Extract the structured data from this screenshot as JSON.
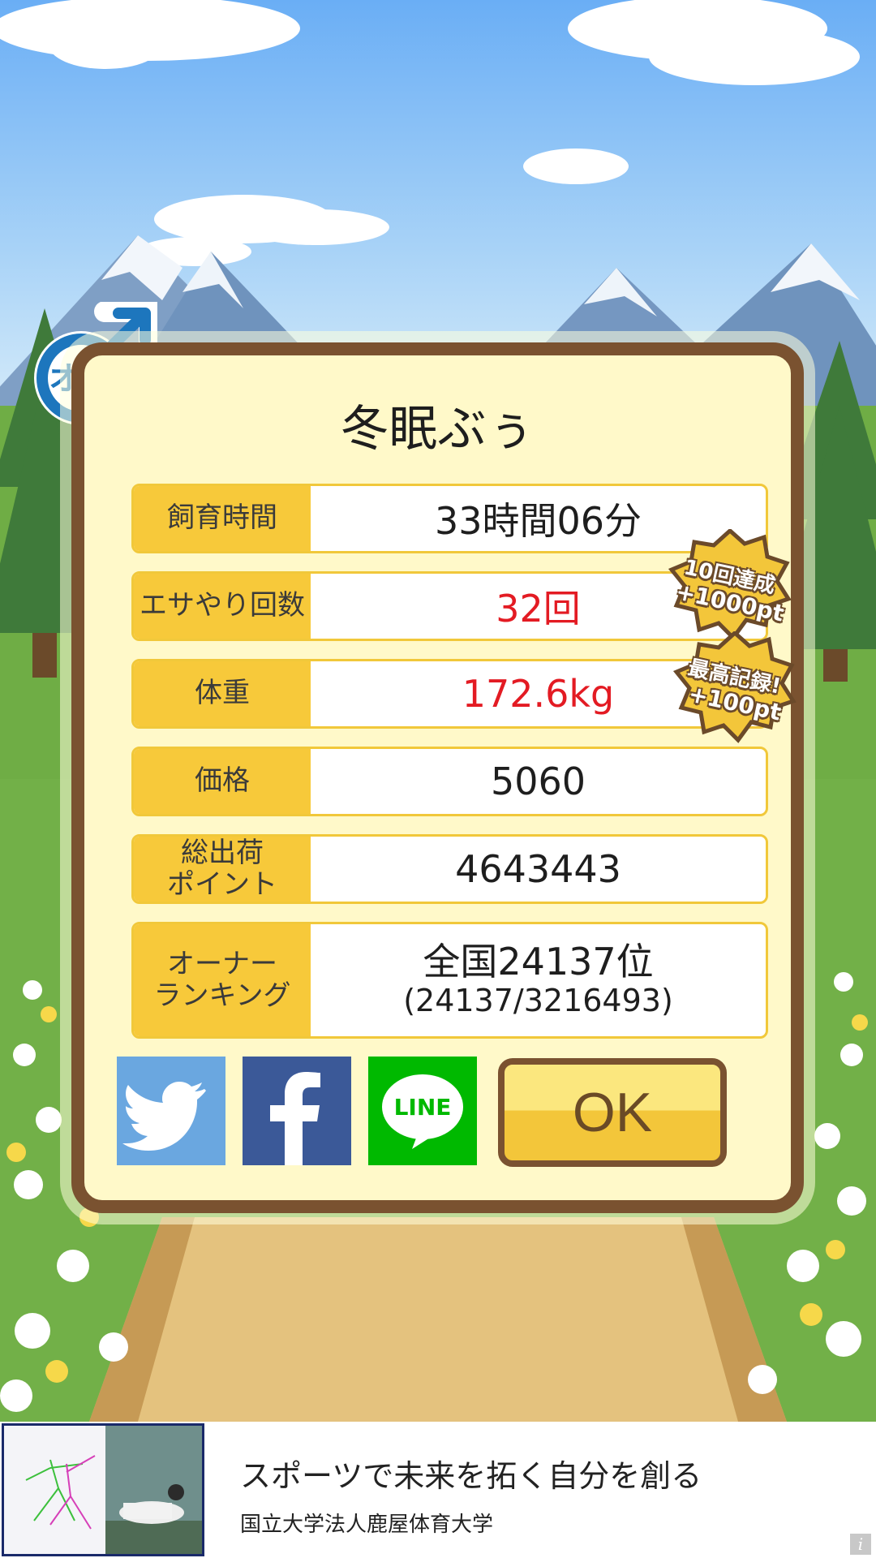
{
  "card": {
    "title": "冬眠ぶぅ",
    "rows": [
      {
        "label": "飼育時間",
        "value": "33時間06分"
      },
      {
        "label": "エサやり回数",
        "value": "32回"
      },
      {
        "label": "体重",
        "value": "172.6kg"
      },
      {
        "label": "価格",
        "value": "5060"
      },
      {
        "label": "総出荷\nポイント",
        "value": "4643443"
      },
      {
        "label": "オーナー\nランキング",
        "value": "全国24137位",
        "sub": "(24137/3216493)"
      }
    ],
    "badges": [
      {
        "line1": "10回達成",
        "line2": "+1000pt"
      },
      {
        "line1": "最高記録!",
        "line2": "+100pt"
      }
    ],
    "gender_label": "オス",
    "ok_label": "OK",
    "social": {
      "twitter": "twitter",
      "facebook": "f",
      "line": "LINE"
    }
  },
  "ad": {
    "title": "スポーツで未来を拓く自分を創る",
    "subtitle": "国立大学法人鹿屋体育大学",
    "info_icon": "i"
  },
  "colors": {
    "accent": "#f7c93a",
    "frame": "#7a5230",
    "highlight_red": "#e31b23",
    "twitter": "#6aa7e0",
    "facebook": "#3b5998",
    "line": "#00b900"
  }
}
